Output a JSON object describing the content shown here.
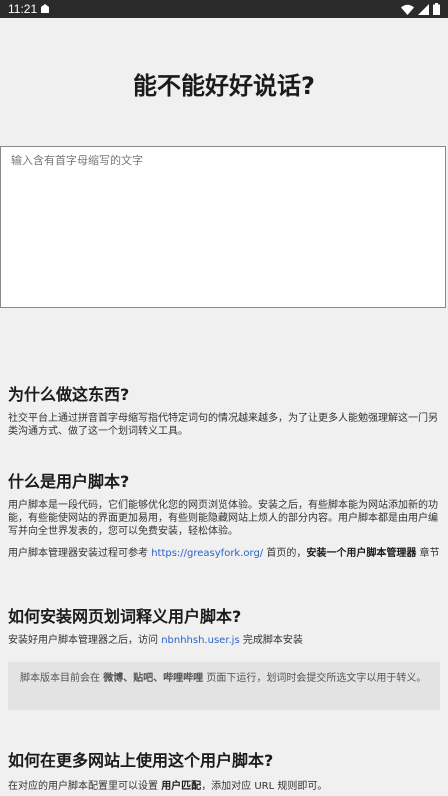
{
  "status": {
    "time": "11:21"
  },
  "header": {
    "title": "能不能好好说话?"
  },
  "input": {
    "placeholder": "输入含有首字母缩写的文字"
  },
  "sections": {
    "why": {
      "title": "为什么做这东西?",
      "text": "社交平台上通过拼音首字母缩写指代特定词句的情况越来越多，为了让更多人能勉强理解这一门另类沟通方式、做了这一个划词转义工具。"
    },
    "userscript": {
      "title": "什么是用户脚本?",
      "text1": "用户脚本是一段代码，它们能够优化您的网页浏览体验。安装之后，有些脚本能为网站添加新的功能，有些能使网站的界面更加易用，有些则能隐藏网站上烦人的部分内容。用户脚本都是由用户编写并向全世界发表的，您可以免费安装，轻松体验。",
      "text2_pre": "用户脚本管理器安装过程可参考 ",
      "text2_link": "https://greasyfork.org/",
      "text2_mid": " 首页的，",
      "text2_bold": "安装一个用户脚本管理器",
      "text2_post": " 章节"
    },
    "install": {
      "title": "如何安装网页划词释义用户脚本?",
      "text_pre": "安装好用户脚本管理器之后，访问 ",
      "text_link": "nbnhhsh.user.js",
      "text_post": " 完成脚本安装",
      "note_pre": "脚本版本目前会在 ",
      "note_bold": "微博、贴吧、哔哩哔哩",
      "note_post": " 页面下运行，划词时会提交所选文字以用于转义。"
    },
    "more": {
      "title": "如何在更多网站上使用这个用户脚本?",
      "text_pre": "在对应的用户脚本配置里可以设置 ",
      "text_bold": "用户匹配",
      "text_post": "，添加对应 URL 规则即可。"
    }
  }
}
